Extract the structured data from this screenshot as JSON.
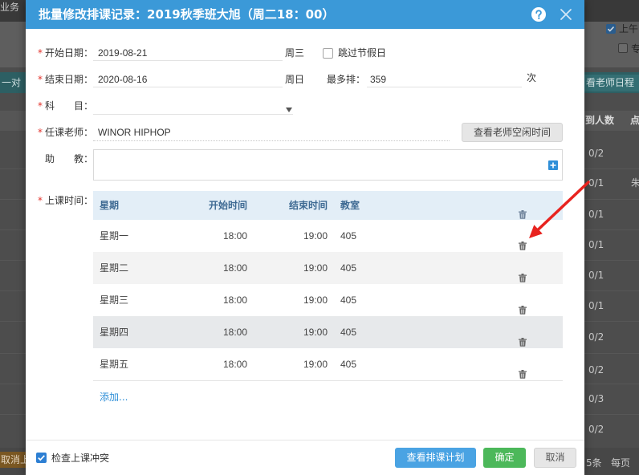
{
  "background": {
    "top_menu_label": "业务",
    "program_tab_label": "一对",
    "morning_filter": {
      "label": "上午",
      "checked": true
    },
    "second_filter": {
      "label": "专",
      "checked": false
    },
    "teacher_schedule_button": "看老师日程",
    "grid": {
      "attendance_header": "到人数",
      "next_header": "点",
      "attendance_values": [
        "0/2",
        "0/1",
        "0/1",
        "0/1",
        "0/1",
        "0/1",
        "0/2",
        "0/2",
        "0/3",
        "0/2"
      ],
      "side_name": "朱"
    },
    "cancel_button": "取消上",
    "pager": {
      "count": "5条",
      "per_page": "每页"
    }
  },
  "dialog": {
    "title": "批量修改排课记录：2019秋季班大旭（周二18：00）",
    "help_icon": "help-icon",
    "close_icon": "close-icon",
    "required_mark": "*",
    "colors": {
      "title_bar": "#3b99d8",
      "primary_button": "#4aa3e3",
      "confirm_button": "#4cb85a",
      "required": "#e2322b",
      "link": "#2f8fd8"
    },
    "form": {
      "start_date": {
        "label": "开始日期：",
        "value": "2019-08-21",
        "weekday": "周三"
      },
      "skip_holidays": {
        "label": "跳过节假日",
        "checked": false
      },
      "end_date": {
        "label": "结束日期：",
        "value": "2020-08-16",
        "weekday": "周日"
      },
      "max_sessions": {
        "label": "最多排：",
        "value": "359",
        "unit": "次"
      },
      "subject": {
        "label": "科　　目：",
        "value": "",
        "dropdown_icon": "caret-down-icon"
      },
      "teacher": {
        "label": "任课老师：",
        "value": "WINOR HIPHOP",
        "free_time_button": "查看老师空闲时间"
      },
      "assistant": {
        "label": "助　　教：",
        "add_icon": "plus-icon"
      },
      "schedule": {
        "label": "上课时间：",
        "columns": [
          "星期",
          "开始时间",
          "结束时间",
          "教室"
        ],
        "delete_icon": "trash-icon",
        "rows": [
          {
            "weekday": "星期一",
            "start": "18:00",
            "end": "19:00",
            "room": "405"
          },
          {
            "weekday": "星期二",
            "start": "18:00",
            "end": "19:00",
            "room": "405"
          },
          {
            "weekday": "星期三",
            "start": "18:00",
            "end": "19:00",
            "room": "405"
          },
          {
            "weekday": "星期四",
            "start": "18:00",
            "end": "19:00",
            "room": "405"
          },
          {
            "weekday": "星期五",
            "start": "18:00",
            "end": "19:00",
            "room": "405"
          }
        ],
        "add_link": "添加..."
      }
    },
    "footer": {
      "check_conflict": {
        "label": "检查上课冲突",
        "checked": true
      },
      "buttons": {
        "view_plan": "查看排课计划",
        "confirm": "确定",
        "cancel": "取消"
      }
    }
  },
  "annotation": {
    "arrow_color": "#e8231f"
  }
}
